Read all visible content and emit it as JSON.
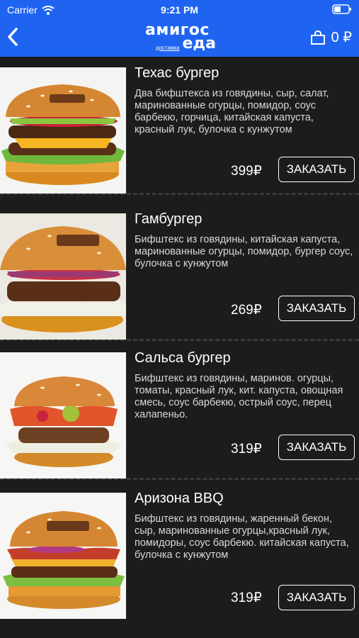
{
  "status_bar": {
    "carrier": "Carrier",
    "time": "9:21 PM"
  },
  "header": {
    "logo_line1": "амигос",
    "logo_small": "доставка",
    "logo_line2": "еда",
    "cart_total": "0 ₽",
    "colors": {
      "bar": "#1f64f0"
    }
  },
  "menu": [
    {
      "title": "Техас бургер",
      "description": "Два бифштекса из говядины, сыр, салат, маринованные огурцы,  помидор, соус барбекю, горчица, китайская капуста, красный лук, булочка с кунжутом",
      "price": "399₽",
      "button": "ЗАКАЗАТЬ"
    },
    {
      "title": "Гамбургер",
      "description": "Бифштекс из говядины, китайская капуста, маринованные огурцы, помидор, бургер соус, булочка с кунжутом",
      "price": "269₽",
      "button": "ЗАКАЗАТЬ"
    },
    {
      "title": "Сальса бургер",
      "description": "Бифштекс из говядины, маринов. огурцы, томаты, красный лук, кит. капуста, овощная смесь, соус барбекю, острый соус, перец халапеньо.",
      "price": "319₽",
      "button": "ЗАКАЗАТЬ"
    },
    {
      "title": "Аризона BBQ",
      "description": "Бифштекс из говядины, жаренный бекон, сыр, маринованные огурцы,красный лук, помидоры, соус барбекю. китайская капуста, булочка с кунжутом",
      "price": "319₽",
      "button": "ЗАКАЗАТЬ"
    }
  ]
}
